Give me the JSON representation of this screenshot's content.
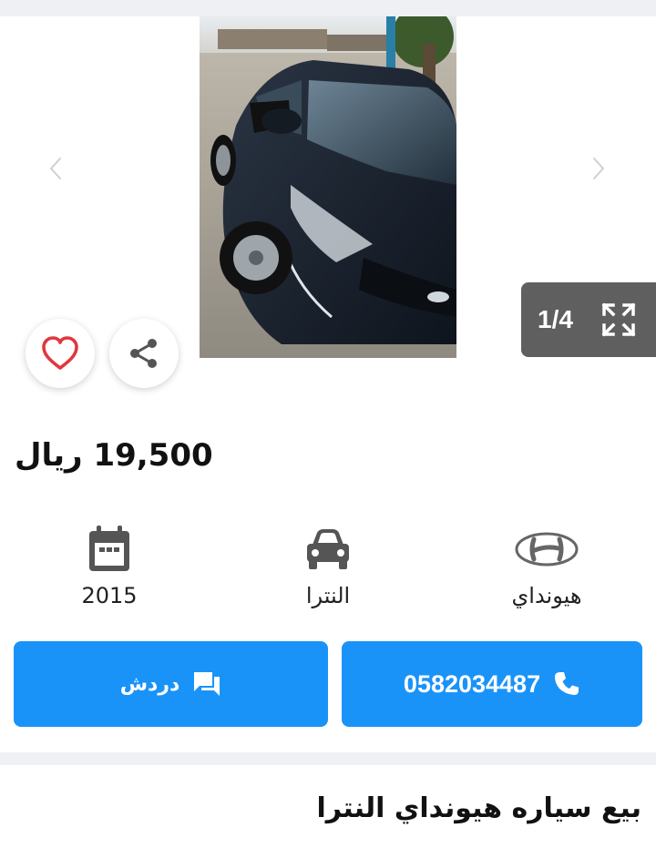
{
  "gallery": {
    "counter_text": "1/4",
    "prev_icon": "chevron-left-icon",
    "next_icon": "chevron-right-icon",
    "fullscreen_icon": "fullscreen-icon",
    "favorite_icon": "heart-icon",
    "share_icon": "share-icon"
  },
  "listing": {
    "price": "19,500 ريال",
    "specs": {
      "year": "2015",
      "model": "النترا",
      "make": "هيونداي"
    },
    "title": "بيع سياره هيونداي النترا"
  },
  "actions": {
    "chat_label": "دردش",
    "phone": "0582034487"
  },
  "colors": {
    "primary": "#1a93f8",
    "heart": "#e0383e",
    "counter_bg": "#5f5f5f",
    "divider": "#eef0f3"
  }
}
